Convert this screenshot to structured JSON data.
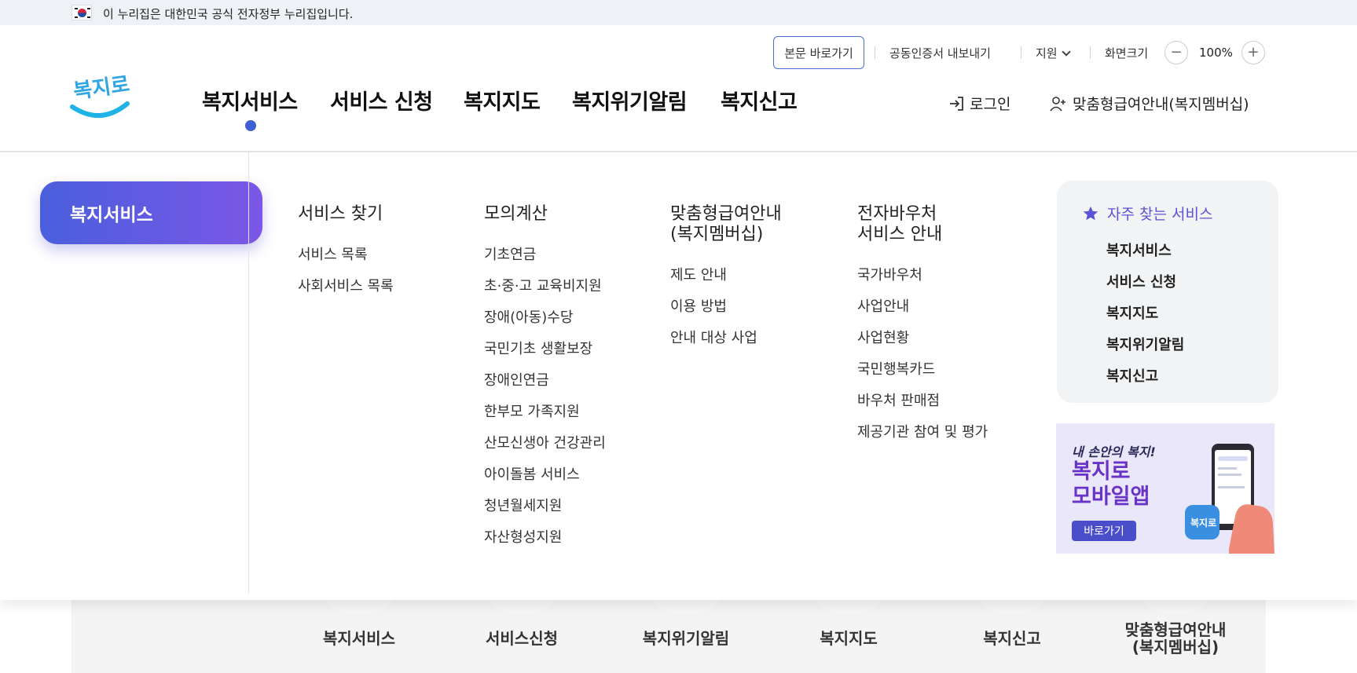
{
  "gov_banner": {
    "text": "이 누리집은 대한민국 공식 전자정부 누리집입니다."
  },
  "utility": {
    "skip": "본문 바로가기",
    "cert": "공동인증서 내보내기",
    "support": "지원",
    "zoom_label": "화면크기",
    "zoom_value": "100%",
    "zoom_out": "−",
    "zoom_in": "+"
  },
  "logo": {
    "text": "복지로",
    "alt_icon": "bokjiro-logo-icon"
  },
  "gnb": {
    "items": [
      "복지서비스",
      "서비스 신청",
      "복지지도",
      "복지위기알림",
      "복지신고"
    ],
    "active_index": 0
  },
  "account": {
    "login": "로그인",
    "member": "맞춤형급여안내(복지멤버십)"
  },
  "mega": {
    "side_title": "복지서비스",
    "columns": [
      {
        "title": "서비스 찾기",
        "items": [
          "서비스 목록",
          "사회서비스 목록"
        ]
      },
      {
        "title": "모의계산",
        "items": [
          "기초연금",
          "초·중·고 교육비지원",
          "장애(아동)수당",
          "국민기초 생활보장",
          "장애인연금",
          "한부모 가족지원",
          "산모신생아 건강관리",
          "아이돌봄 서비스",
          "청년월세지원",
          "자산형성지원"
        ]
      },
      {
        "title": "맞춤형급여안내\n(복지멤버십)",
        "items": [
          "제도 안내",
          "이용 방법",
          "안내 대상 사업"
        ]
      },
      {
        "title": "전자바우처\n서비스 안내",
        "items": [
          "국가바우처",
          "사업안내",
          "사업현황",
          "국민행복카드",
          "바우처 판매점",
          "제공기관 참여 및 평가"
        ]
      }
    ],
    "favorites": {
      "title": "자주 찾는 서비스",
      "items": [
        "복지서비스",
        "서비스 신청",
        "복지지도",
        "복지위기알림",
        "복지신고"
      ]
    },
    "banner": {
      "sub": "내 손안의 복지!",
      "main": "복지로\n모바일앱",
      "button": "바로가기"
    }
  },
  "quick_menu": {
    "items": [
      "복지서비스",
      "서비스신청",
      "복지위기알림",
      "복지지도",
      "복지신고",
      "맞춤형급여안내\n(복지멤버십)"
    ]
  },
  "colors": {
    "accent": "#3e60d6",
    "gradient_start": "#4a5fdc",
    "gradient_end": "#7b57e6",
    "favorite_title": "#5b52d8"
  }
}
